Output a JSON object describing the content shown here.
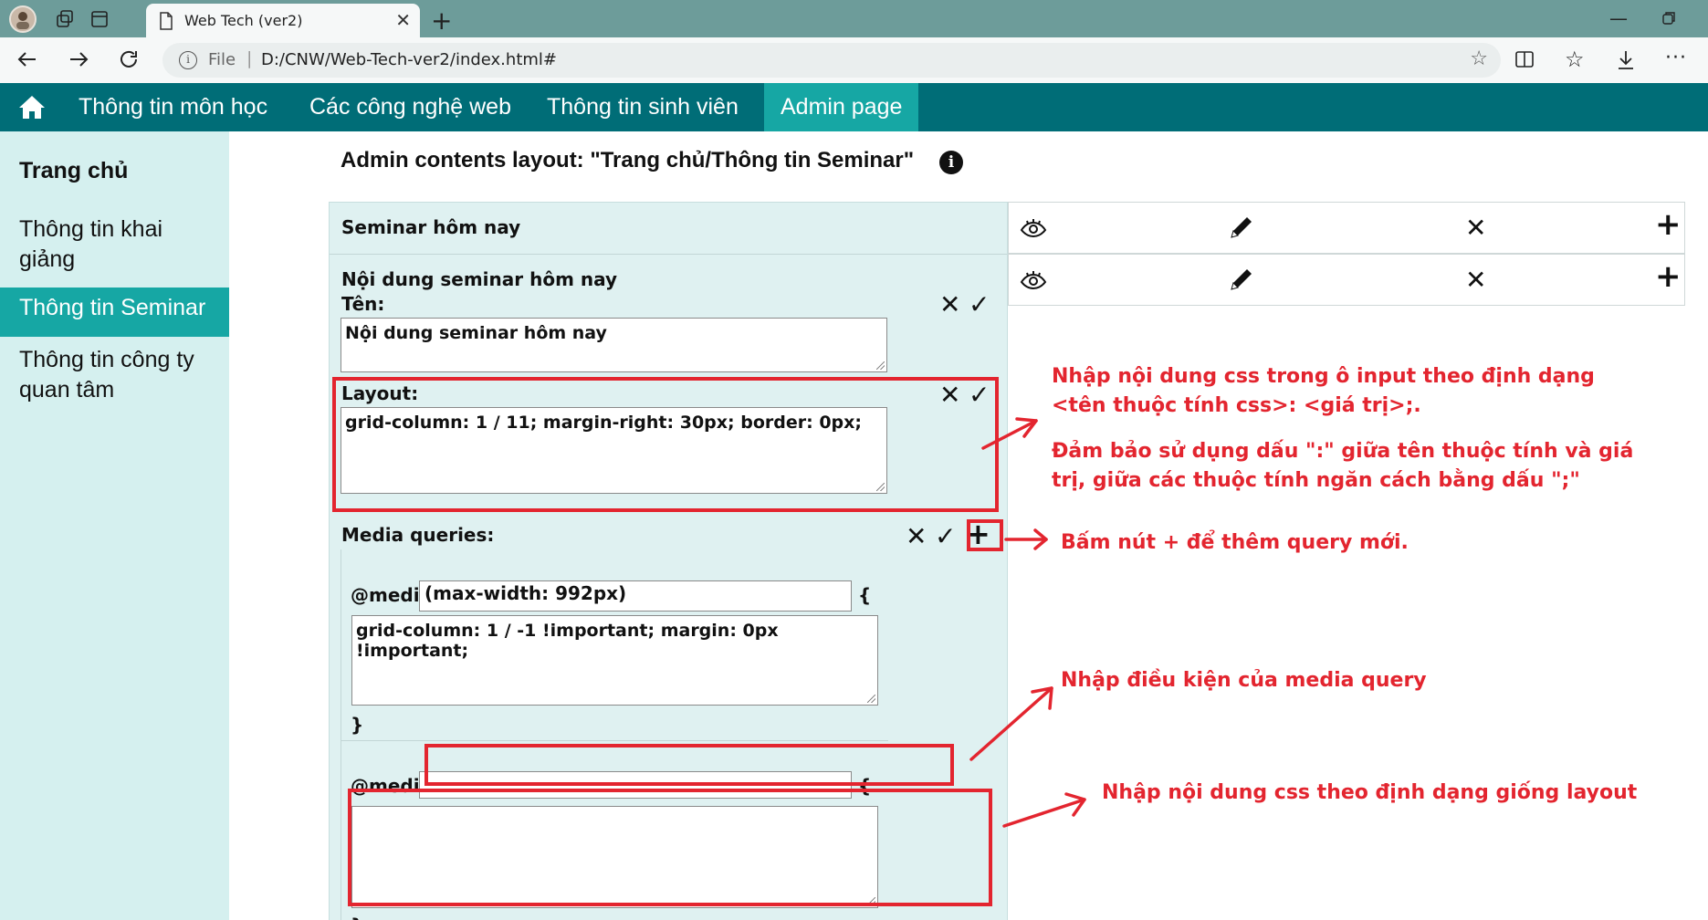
{
  "browser": {
    "tab_title": "Web Tech (ver2)",
    "file_label": "File",
    "separator": "|",
    "url": "D:/CNW/Web-Tech-ver2/index.html#"
  },
  "nav": {
    "items": [
      "Thông tin môn học",
      "Các công nghệ web",
      "Thông tin sinh viên",
      "Admin page"
    ],
    "active": "Admin page"
  },
  "sidebar": {
    "title": "Trang chủ",
    "items": [
      "Thông tin khai giảng",
      "Thông tin Seminar",
      "Thông tin công ty quan tâm"
    ],
    "active": "Thông tin Seminar"
  },
  "main": {
    "title": "Admin contents layout: \"Trang chủ/Thông tin Seminar\"",
    "row1_label": "Seminar hôm nay",
    "section_heading": "Nội dung seminar hôm nay",
    "name_label": "Tên:",
    "name_value": "Nội dung seminar hôm nay",
    "layout_label": "Layout:",
    "layout_value": "grid-column: 1 / 11; margin-right: 30px; border: 0px;",
    "media_label": "Media queries:",
    "media_keyword": "@media",
    "media1_condition": "(max-width: 992px)",
    "open_brace": "{",
    "close_brace": "}",
    "media1_css": "grid-column: 1 / -1 !important; margin: 0px !important;",
    "media2_condition": "",
    "media2_css": ""
  },
  "annotations": {
    "note1_line1": "Nhập nội dung css trong ô input theo định dạng",
    "note1_line2": "<tên thuộc tính css>: <giá trị>;.",
    "note2_line1": "Đảm bảo sử dụng dấu \":\" giữa tên thuộc tính và giá",
    "note2_line2": "trị, giữa các thuộc tính ngăn cách bằng dấu \";\"",
    "note3": "Bấm nút + để thêm query mới.",
    "note4": "Nhập điều kiện của media query",
    "note5": "Nhập nội dung css theo định dạng giống layout"
  },
  "colors": {
    "nav_bg": "#006d77",
    "accent": "#16a7a4",
    "sidebar_bg": "#d5f0ef",
    "panel_bg": "#dff1f1",
    "annotation": "#e3252f"
  }
}
